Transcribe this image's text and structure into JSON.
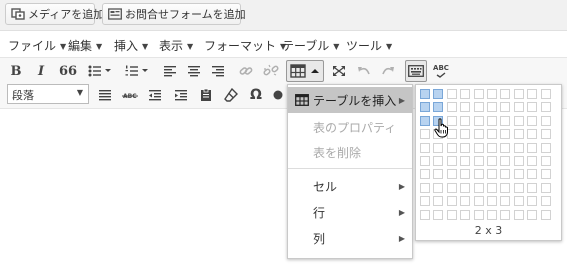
{
  "buttons": {
    "add_media": "メディアを追加",
    "add_contact_form": "お問合せフォームを追加"
  },
  "menubar": [
    "ファイル",
    "編集",
    "挿入",
    "表示",
    "フォーマット",
    "テーブル",
    "ツール"
  ],
  "toolbar": {
    "format_select_value": "段落",
    "bold_label": "B",
    "italic_label": "I",
    "quote_label": "66",
    "spellcheck_label": "ABC",
    "omega_label": "Ω"
  },
  "table_menu": {
    "insert_table": "テーブルを挿入",
    "table_properties": "表のプロパティ",
    "delete_table": "表を削除",
    "cell": "セル",
    "row": "行",
    "column": "列"
  },
  "table_grid": {
    "columns": 10,
    "rows": 10,
    "selected_cols": 2,
    "selected_rows": 3,
    "size_label": "2 x 3"
  },
  "colors": {
    "highlight": "#c5c5c5",
    "grid_selected": "#b8d3f0"
  }
}
